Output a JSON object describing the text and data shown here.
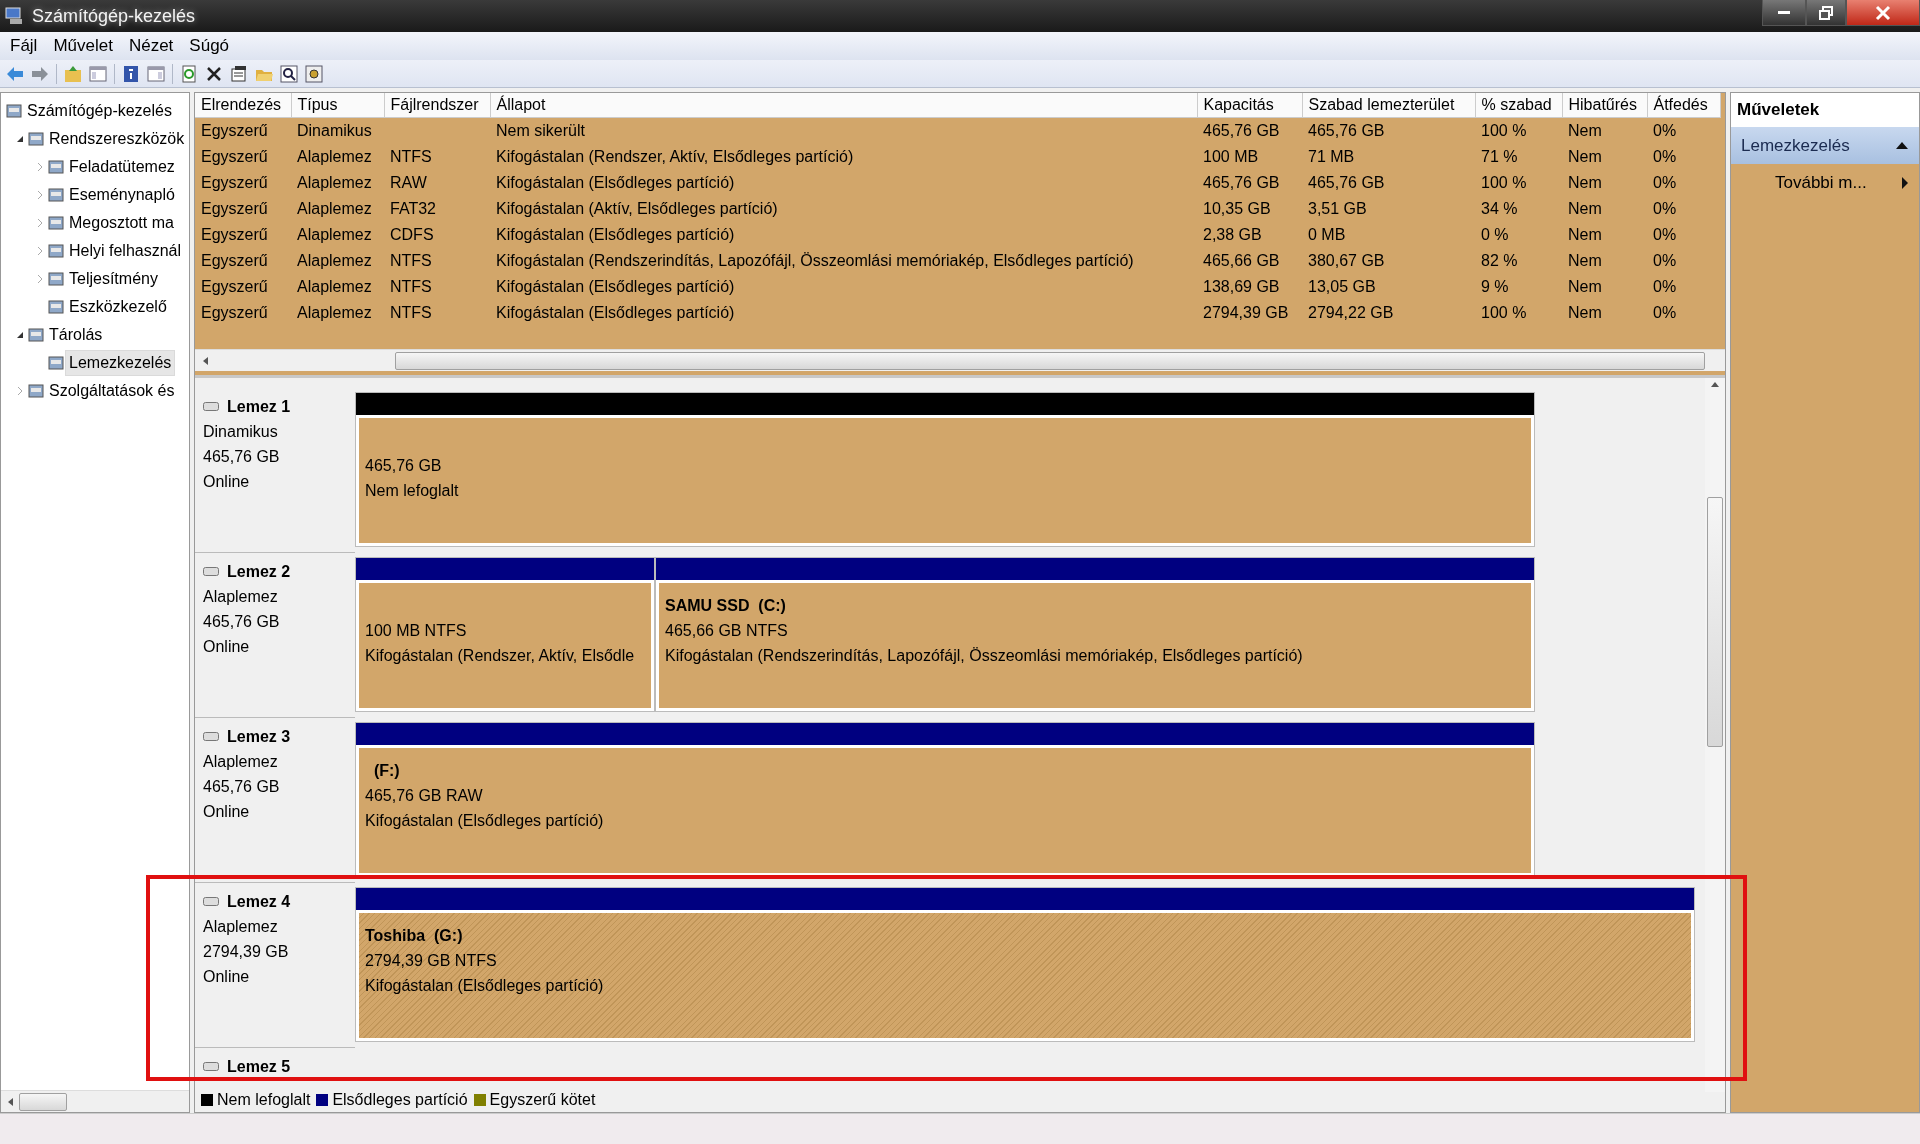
{
  "window": {
    "title": "Számítógép-kezelés"
  },
  "menu": [
    "Fájl",
    "Művelet",
    "Nézet",
    "Súgó"
  ],
  "tree": [
    {
      "label": "Számítógép-kezelés",
      "selected": false,
      "children": [
        {
          "label": "Rendszereszközök",
          "expanded": true,
          "selected": false,
          "children": [
            {
              "label": "Feladatütemez",
              "expanded": false,
              "selected": false
            },
            {
              "label": "Eseménynapló",
              "expanded": false,
              "selected": false
            },
            {
              "label": "Megosztott ma",
              "expanded": false,
              "selected": false
            },
            {
              "label": "Helyi felhasznál",
              "expanded": false,
              "selected": false
            },
            {
              "label": "Teljesítmény",
              "expanded": false,
              "selected": false
            },
            {
              "label": "Eszközkezelő",
              "selected": false
            }
          ]
        },
        {
          "label": "Tárolás",
          "expanded": true,
          "selected": false,
          "children": [
            {
              "label": "Lemezkezelés",
              "selected": true
            }
          ]
        },
        {
          "label": "Szolgáltatások és",
          "expanded": false,
          "selected": false
        }
      ]
    }
  ],
  "table": {
    "columns": [
      "Elrendezés",
      "Típus",
      "Fájlrendszer",
      "Állapot",
      "Kapacitás",
      "Szabad lemezterület",
      "% szabad",
      "Hibatűrés",
      "Átfedés"
    ],
    "rows": [
      {
        "layout": "Egyszerű",
        "type": "Dinamikus",
        "status": "Nem sikerült",
        "capacity": "465,76 GB",
        "free_space": "465,76 GB",
        "percent_free": "100 %",
        "fault_tolerance": "Nem",
        "overhead": "0%"
      },
      {
        "layout": "Egyszerű",
        "type": "Alaplemez",
        "filesystem": "NTFS",
        "status": "Kifogástalan (Rendszer, Aktív, Elsődleges partíció)",
        "capacity": "100 MB",
        "free_space": "71 MB",
        "percent_free": "71 %",
        "fault_tolerance": "Nem",
        "overhead": "0%"
      },
      {
        "layout": "Egyszerű",
        "type": "Alaplemez",
        "filesystem": "RAW",
        "status": "Kifogástalan (Elsődleges partíció)",
        "capacity": "465,76 GB",
        "free_space": "465,76 GB",
        "percent_free": "100 %",
        "fault_tolerance": "Nem",
        "overhead": "0%"
      },
      {
        "layout": "Egyszerű",
        "type": "Alaplemez",
        "filesystem": "FAT32",
        "status": "Kifogástalan (Aktív, Elsődleges partíció)",
        "capacity": "10,35 GB",
        "free_space": "3,51 GB",
        "percent_free": "34 %",
        "fault_tolerance": "Nem",
        "overhead": "0%"
      },
      {
        "layout": "Egyszerű",
        "type": "Alaplemez",
        "filesystem": "CDFS",
        "status": "Kifogástalan (Elsődleges partíció)",
        "capacity": "2,38 GB",
        "free_space": "0 MB",
        "percent_free": "0 %",
        "fault_tolerance": "Nem",
        "overhead": "0%"
      },
      {
        "layout": "Egyszerű",
        "type": "Alaplemez",
        "filesystem": "NTFS",
        "status": "Kifogástalan (Rendszerindítás, Lapozófájl, Összeomlási memóriakép, Elsődleges partíció)",
        "capacity": "465,66 GB",
        "free_space": "380,67 GB",
        "percent_free": "82 %",
        "fault_tolerance": "Nem",
        "overhead": "0%"
      },
      {
        "layout": "Egyszerű",
        "type": "Alaplemez",
        "filesystem": "NTFS",
        "status": "Kifogástalan (Elsődleges partíció)",
        "capacity": "138,69 GB",
        "free_space": "13,05 GB",
        "percent_free": "9 %",
        "fault_tolerance": "Nem",
        "overhead": "0%"
      },
      {
        "layout": "Egyszerű",
        "type": "Alaplemez",
        "filesystem": "NTFS",
        "status": "Kifogástalan (Elsődleges partíció)",
        "capacity": "2794,39 GB",
        "free_space": "2794,22 GB",
        "percent_free": "100 %",
        "fault_tolerance": "Nem",
        "overhead": "0%"
      }
    ]
  },
  "disks": [
    {
      "name": "Lemez 1",
      "type": "Dinamikus",
      "size": "465,76 GB",
      "status": "Online",
      "partitions": [
        {
          "kind": "unallocated",
          "selected": false,
          "size": "465,76 GB",
          "status": "Nem lefoglalt"
        }
      ]
    },
    {
      "name": "Lemez 2",
      "type": "Alaplemez",
      "size": "465,76 GB",
      "status": "Online",
      "partitions": [
        {
          "kind": "primary",
          "selected": false,
          "size": "100 MB NTFS",
          "status": "Kifogástalan (Rendszer, Aktív, Elsődle"
        },
        {
          "kind": "primary",
          "selected": false,
          "label": "SAMU SSD  (C:)",
          "size": "465,66 GB NTFS",
          "status": "Kifogástalan (Rendszerindítás, Lapozófájl, Összeomlási memóriakép, Elsődleges partíció)"
        }
      ]
    },
    {
      "name": "Lemez 3",
      "type": "Alaplemez",
      "size": "465,76 GB",
      "status": "Online",
      "partitions": [
        {
          "kind": "primary",
          "selected": false,
          "label": "  (F:)",
          "size": "465,76 GB RAW",
          "status": "Kifogástalan (Elsődleges partíció)"
        }
      ]
    },
    {
      "name": "Lemez 4",
      "type": "Alaplemez",
      "size": "2794,39 GB",
      "status": "Online",
      "partitions": [
        {
          "kind": "primary",
          "selected": true,
          "label": "Toshiba  (G:)",
          "size": "2794,39 GB NTFS",
          "status": "Kifogástalan (Elsődleges partíció)"
        }
      ]
    },
    {
      "name": "Lemez 5"
    }
  ],
  "legend": [
    {
      "label": "Nem lefoglalt",
      "color": "#000000"
    },
    {
      "label": "Elsődleges partíció",
      "color": "#000080"
    },
    {
      "label": "Egyszerű kötet",
      "color": "#808000"
    }
  ],
  "actions": {
    "title": "Műveletek",
    "section": {
      "label": "Lemezkezelés",
      "expanded": true
    },
    "items": [
      "További m..."
    ]
  }
}
